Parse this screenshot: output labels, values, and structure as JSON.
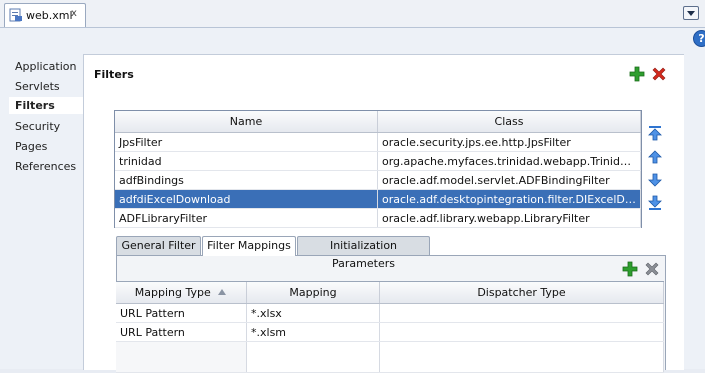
{
  "tab": {
    "title": "web.xml",
    "close": "x"
  },
  "help": {
    "label": "?"
  },
  "nav": {
    "items": [
      "Application",
      "Servlets",
      "Filters",
      "Security",
      "Pages",
      "References"
    ],
    "selected": "Filters"
  },
  "section": {
    "title": "Filters"
  },
  "filters_table": {
    "headers": [
      "Name",
      "Class"
    ],
    "rows": [
      [
        "JpsFilter",
        "oracle.security.jps.ee.http.JpsFilter"
      ],
      [
        "trinidad",
        "org.apache.myfaces.trinidad.webapp.TrinidadFilter"
      ],
      [
        "adfBindings",
        "oracle.adf.model.servlet.ADFBindingFilter"
      ],
      [
        "adfdiExcelDownload",
        "oracle.adf.desktopintegration.filter.DIExcelDownl..."
      ],
      [
        "ADFLibraryFilter",
        "oracle.adf.library.webapp.LibraryFilter"
      ]
    ],
    "selected_row": 3
  },
  "subtabs": [
    "General Filter",
    "Filter Mappings",
    "Initialization Parameters"
  ],
  "selected_subtab": "Filter Mappings",
  "mappings_table": {
    "headers": [
      "Mapping Type",
      "Mapping",
      "Dispatcher Type"
    ],
    "rows": [
      [
        "URL Pattern",
        "*.xlsx",
        ""
      ],
      [
        "URL Pattern",
        "*.xlsm",
        ""
      ]
    ]
  },
  "colors": {
    "selection": "#3a6fb7",
    "add": "#2e9e2e",
    "delete": "#d42a1e",
    "arrow": "#2f74d0"
  }
}
